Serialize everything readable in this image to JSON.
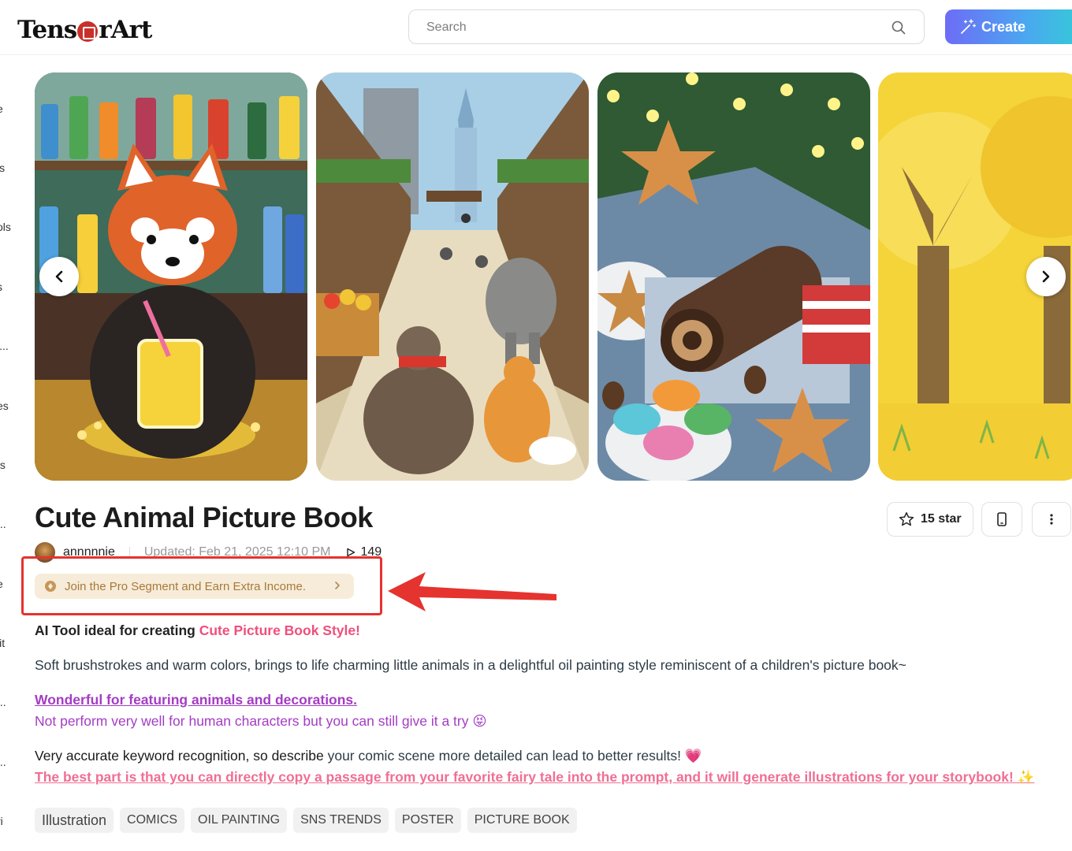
{
  "header": {
    "logo": {
      "part1": "Tens",
      "part2": "r",
      "part3": "Art"
    },
    "search_placeholder": "Search",
    "create_label": "Create"
  },
  "sidebar": {
    "items": [
      "e",
      "ls",
      "ols",
      "s",
      "l...",
      "es",
      "ts",
      "...",
      "e",
      "iit",
      "...",
      "...",
      "ri"
    ]
  },
  "carousel": {
    "slides": [
      {
        "subject": "red panda drinking lemonade at a bar"
      },
      {
        "subject": "otter and fox in a city market street"
      },
      {
        "subject": "holiday cookies, yule log cake and macarons"
      },
      {
        "subject": "yellow autumn forest"
      }
    ]
  },
  "model": {
    "title": "Cute Animal Picture Book",
    "star_label": "15 star",
    "author": "annnnnie",
    "updated": "Updated: Feb 21, 2025 12:10 PM",
    "runs": "149",
    "promo": "Join the Pro Segment and Earn Extra Income."
  },
  "description": {
    "line1_prefix": "AI Tool ideal for creating ",
    "line1_highlight": "Cute Picture Book Style!",
    "line2": "Soft brushstrokes and warm colors, brings to life charming little animals in a delightful oil painting style reminiscent of a children's picture book~",
    "line3_link": "Wonderful for featuring animals and decorations.",
    "line4": "Not perform very well for human characters but you can still give it a try 😝",
    "line5_a": "Very ",
    "line5_b": "accurate keyword recognition, so describe ",
    "line5_c": "your comic scene more detailed can lead to better results! 💗",
    "line6_link": "The best part is that you can directly copy a passage from your favorite fairy tale into the prompt, and it will generate illustrations for your storybook! ✨"
  },
  "tags": [
    "Illustration",
    "COMICS",
    "OIL PAINTING",
    "SNS TRENDS",
    "POSTER",
    "PICTURE BOOK"
  ],
  "colors": {
    "accent_pink": "#ef4f7c",
    "accent_purple": "#a43cc4",
    "annotation_red": "#e5332f",
    "promo_bg": "#f6ecd9"
  }
}
